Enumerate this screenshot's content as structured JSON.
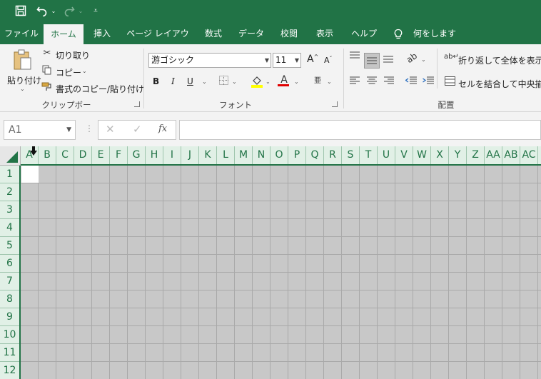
{
  "qat": {
    "save_icon": "save-icon",
    "undo_icon": "undo-icon",
    "redo_icon": "redo-icon",
    "customize_icon": "customize-qat-icon"
  },
  "tabs": [
    {
      "label": "ファイル"
    },
    {
      "label": "ホーム"
    },
    {
      "label": "挿入"
    },
    {
      "label": "ページ レイアウト"
    },
    {
      "label": "数式"
    },
    {
      "label": "データ"
    },
    {
      "label": "校閲"
    },
    {
      "label": "表示"
    },
    {
      "label": "ヘルプ"
    },
    {
      "label": "何をしますか"
    }
  ],
  "clipboard": {
    "paste": "貼り付け",
    "cut": "切り取り",
    "copy": "コピー",
    "format_painter": "書式のコピー/貼り付け",
    "group": "クリップボード"
  },
  "font": {
    "name": "游ゴシック",
    "size": "11",
    "bold": "B",
    "italic": "I",
    "underline": "U",
    "font_color": "A",
    "increase": "A",
    "decrease": "A",
    "phonetic": "亜",
    "group": "フォント",
    "accent_red": "#e00000",
    "highlight_yellow": "#ffff00"
  },
  "alignment": {
    "wrap_text": "折り返して全体を表示す",
    "merge_center": "セルを結合して中央揃え",
    "group": "配置"
  },
  "formula_bar": {
    "name_box": "A1",
    "cancel": "✕",
    "enter": "✓",
    "fx": "fx",
    "value": ""
  },
  "grid": {
    "columns": [
      "A",
      "B",
      "C",
      "D",
      "E",
      "F",
      "G",
      "H",
      "I",
      "J",
      "K",
      "L",
      "M",
      "N",
      "O",
      "P",
      "Q",
      "R",
      "S",
      "T",
      "U",
      "V",
      "W",
      "X",
      "Y",
      "Z",
      "AA",
      "AB",
      "AC",
      "A"
    ],
    "rows": [
      "1",
      "2",
      "3",
      "4",
      "5",
      "6",
      "7",
      "8",
      "9",
      "10",
      "11",
      "12"
    ],
    "active_cell": "A1"
  },
  "colors": {
    "brand": "#217346",
    "header_bg": "#e1f0e6",
    "cell_bg": "#c8c8c8"
  }
}
